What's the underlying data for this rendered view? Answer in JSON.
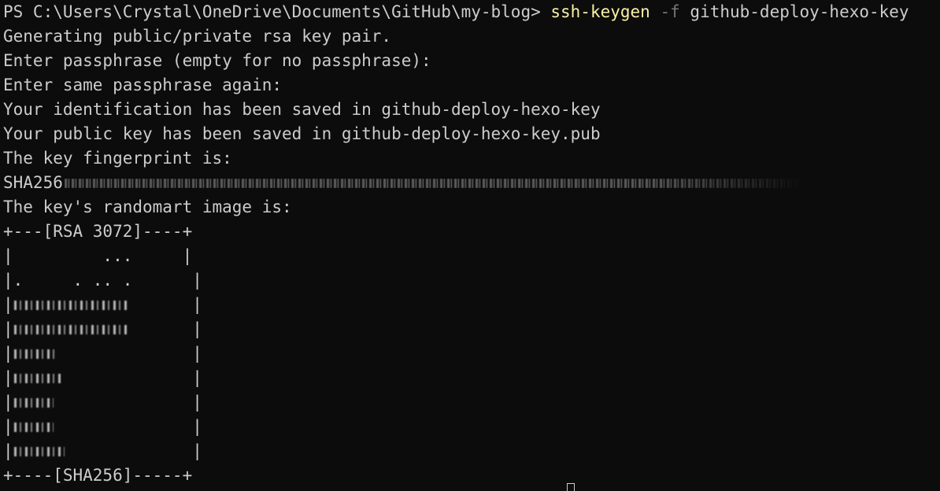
{
  "terminal": {
    "prompt": "PS C:\\Users\\Crystal\\OneDrive\\Documents\\GitHub\\my-blog> ",
    "command": {
      "name": "ssh-keygen",
      "flag": "-f",
      "arg": "github-deploy-hexo-key"
    },
    "output": [
      "Generating public/private rsa key pair.",
      "Enter passphrase (empty for no passphrase):",
      "Enter same passphrase again:",
      "Your identification has been saved in github-deploy-hexo-key",
      "Your public key has been saved in github-deploy-hexo-key.pub",
      "The key fingerprint is:"
    ],
    "fingerprint_prefix": "SHA256",
    "randomart_intro": "The key's randomart image is:",
    "randomart": {
      "header": "+---[RSA 3072]----+",
      "rows": [
        "|         ...     |",
        "|.     . .. .      |",
        "|                  |",
        "|                  |",
        "|                  |",
        "|                  |",
        "|                  |",
        "|                  |",
        "|                  |"
      ],
      "footer": "+----[SHA256]-----+"
    },
    "colors": {
      "background": "#0c0c0c",
      "text": "#cccccc",
      "command": "#f9f1a5",
      "flag": "#767676"
    }
  }
}
